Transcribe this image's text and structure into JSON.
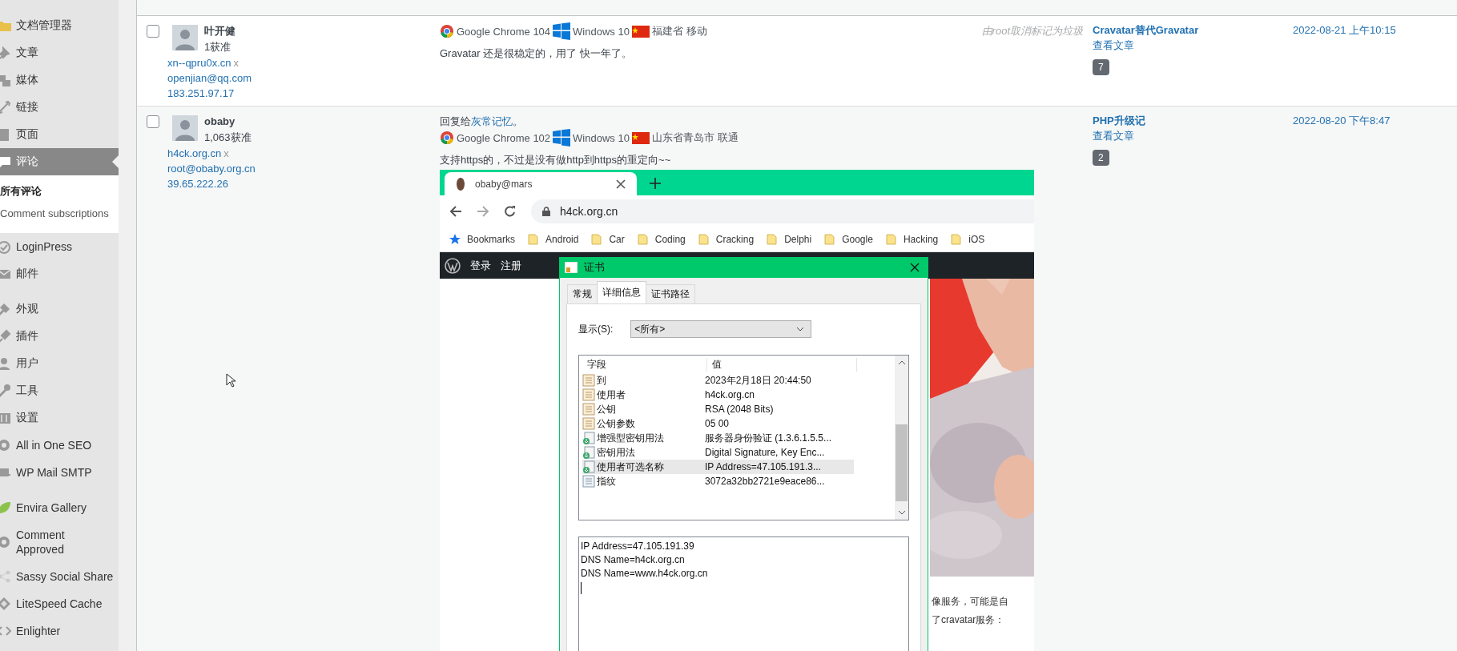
{
  "sidebar": {
    "items": [
      {
        "label": "文档管理器",
        "selected": false
      },
      {
        "label": "文章",
        "selected": false
      },
      {
        "label": "媒体",
        "selected": false
      },
      {
        "label": "链接",
        "selected": false
      },
      {
        "label": "页面",
        "selected": false
      },
      {
        "label": "评论",
        "selected": true,
        "children": [
          {
            "label": "所有评论",
            "selected": true
          },
          {
            "label": "Comment subscriptions",
            "selected": false
          }
        ]
      },
      {
        "label": "LoginPress",
        "selected": false
      },
      {
        "label": "邮件",
        "selected": false
      },
      {
        "label": "外观",
        "selected": false
      },
      {
        "label": "插件",
        "selected": false
      },
      {
        "label": "用户",
        "selected": false
      },
      {
        "label": "工具",
        "selected": false
      },
      {
        "label": "设置",
        "selected": false
      },
      {
        "label": "All in One SEO",
        "selected": false
      },
      {
        "label": "WP Mail SMTP",
        "selected": false
      },
      {
        "label": "Envira Gallery",
        "selected": false
      },
      {
        "label": "Comment Approved",
        "selected": false
      },
      {
        "label": "Sassy Social Share",
        "selected": false
      },
      {
        "label": "LiteSpeed Cache",
        "selected": false
      },
      {
        "label": "Enlighter",
        "selected": false
      }
    ]
  },
  "comments": [
    {
      "checked": false,
      "author": "叶开健",
      "approved": "1获准",
      "url": "xn--qpru0x.cn",
      "url_remove": "x",
      "email": "openjian@qq.com",
      "ip": "183.251.97.17",
      "browser": "Google Chrome 104",
      "os": "Windows 10",
      "location": "福建省 移动",
      "text": "Gravatar 还是很稳定的，用了 快一年了。",
      "note": "由root取消标记为垃圾",
      "post_title": "Cravatar替代Gravatar",
      "view_post": "查看文章",
      "comment_count": "7",
      "date": "2022-08-21 上午10:15"
    },
    {
      "checked": false,
      "author": "obaby",
      "approved": "1,063获准",
      "url": "h4ck.org.cn",
      "url_remove": "x",
      "email": "root@obaby.org.cn",
      "ip": "39.65.222.26",
      "reply_prefix": "回复给",
      "reply_link": "灰常记忆",
      "reply_suffix": "。",
      "browser": "Google Chrome 102",
      "os": "Windows 10",
      "location": "山东省青岛市 联通",
      "text": "支持https的，不过是没有做http到https的重定向~~",
      "post_title": "PHP升级记",
      "view_post": "查看文章",
      "comment_count": "2",
      "date": "2022-08-20 下午8:47",
      "screenshot": {
        "tab_title": "obaby@mars",
        "address": "h4ck.org.cn",
        "bookmarks": [
          {
            "label": "Bookmarks",
            "kind": "star"
          },
          {
            "label": "Android",
            "kind": "folder"
          },
          {
            "label": "Car",
            "kind": "folder"
          },
          {
            "label": "Coding",
            "kind": "folder"
          },
          {
            "label": "Cracking",
            "kind": "folder"
          },
          {
            "label": "Delphi",
            "kind": "folder"
          },
          {
            "label": "Google",
            "kind": "folder"
          },
          {
            "label": "Hacking",
            "kind": "folder"
          },
          {
            "label": "iOS",
            "kind": "folder"
          }
        ],
        "site_links": [
          "登录",
          "注册"
        ],
        "page_text": [
          "像服务，可能是自",
          "了cravatar服务："
        ],
        "dialog": {
          "title": "证书",
          "tabs": [
            {
              "label": "常规",
              "selected": false
            },
            {
              "label": "详细信息",
              "selected": true
            },
            {
              "label": "证书路径",
              "selected": false
            }
          ],
          "show_label": "显示(S):",
          "show_value": "<所有>",
          "columns": [
            "字段",
            "值"
          ],
          "fields": [
            {
              "name": "到",
              "value": "2023年2月18日 20:44:50",
              "kind": "property",
              "selected": false
            },
            {
              "name": "使用者",
              "value": "h4ck.org.cn",
              "kind": "property",
              "selected": false
            },
            {
              "name": "公钥",
              "value": "RSA (2048 Bits)",
              "kind": "property",
              "selected": false
            },
            {
              "name": "公钥参数",
              "value": "05 00",
              "kind": "property",
              "selected": false
            },
            {
              "name": "增强型密钥用法",
              "value": "服务器身份验证 (1.3.6.1.5.5...",
              "kind": "extension",
              "selected": false
            },
            {
              "name": "密钥用法",
              "value": "Digital Signature, Key Enc...",
              "kind": "extension",
              "selected": false
            },
            {
              "name": "使用者可选名称",
              "value": "IP Address=47.105.191.3...",
              "kind": "extension",
              "selected": true
            },
            {
              "name": "指纹",
              "value": "3072a32bb2721e9eace86...",
              "kind": "thumbprint",
              "selected": false
            }
          ],
          "detail_lines": [
            "IP Address=47.105.191.39",
            "DNS Name=h4ck.org.cn",
            "DNS Name=www.h4ck.org.cn"
          ]
        }
      }
    }
  ]
}
